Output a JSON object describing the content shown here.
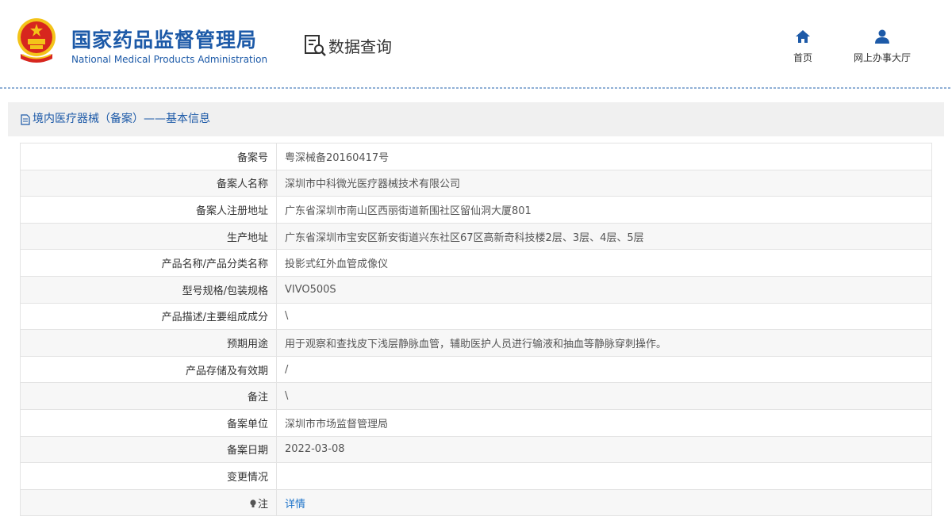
{
  "header": {
    "agency_cn": "国家药品监督管理局",
    "agency_en": "National Medical Products Administration",
    "query_label": "数据查询",
    "nav": {
      "home": "首页",
      "hall": "网上办事大厅"
    }
  },
  "panel": {
    "title": "境内医疗器械（备案）——基本信息"
  },
  "rows": [
    {
      "label": "备案号",
      "value": "粤深械备20160417号"
    },
    {
      "label": "备案人名称",
      "value": "深圳市中科微光医疗器械技术有限公司"
    },
    {
      "label": "备案人注册地址",
      "value": "广东省深圳市南山区西丽街道新围社区留仙洞大厦801"
    },
    {
      "label": "生产地址",
      "value": "广东省深圳市宝安区新安街道兴东社区67区高新奇科技楼2层、3层、4层、5层"
    },
    {
      "label": "产品名称/产品分类名称",
      "value": "投影式红外血管成像仪"
    },
    {
      "label": "型号规格/包装规格",
      "value": "VIVO500S"
    },
    {
      "label": "产品描述/主要组成成分",
      "value": "\\"
    },
    {
      "label": "预期用途",
      "value": "用于观察和查找皮下浅层静脉血管，辅助医护人员进行输液和抽血等静脉穿刺操作。"
    },
    {
      "label": "产品存储及有效期",
      "value": "/"
    },
    {
      "label": "备注",
      "value": "\\"
    },
    {
      "label": "备案单位",
      "value": "深圳市市场监督管理局"
    },
    {
      "label": "备案日期",
      "value": "2022-03-08"
    },
    {
      "label": "变更情况",
      "value": ""
    },
    {
      "label": "注",
      "value": "详情"
    }
  ],
  "colors": {
    "brand_blue": "#1d5aa8",
    "link_blue": "#1d73c9",
    "emblem_red": "#d7261e",
    "emblem_gold": "#f3c319"
  }
}
